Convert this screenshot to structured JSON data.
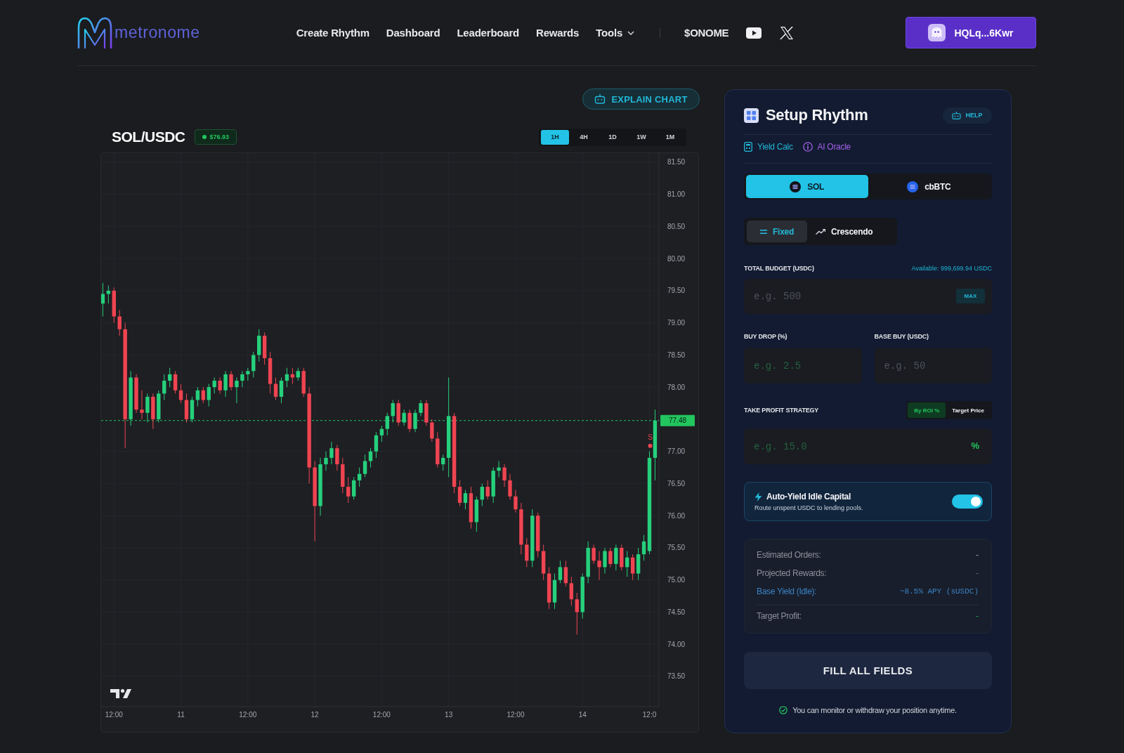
{
  "header": {
    "logo": "metronome",
    "nav": [
      {
        "label": "Create Rhythm",
        "dropdown": false
      },
      {
        "label": "Dashboard",
        "dropdown": false
      },
      {
        "label": "Leaderboard",
        "dropdown": false
      },
      {
        "label": "Rewards",
        "dropdown": false
      },
      {
        "label": "Tools",
        "dropdown": true
      }
    ],
    "token": "$ONOME",
    "wallet": "HQLq...6Kwr"
  },
  "chart": {
    "explain_button": "EXPLAIN CHART",
    "pair": "SOL/USDC",
    "price_badge": "$76.93",
    "timeframes": [
      {
        "label": "1H",
        "selected": true
      },
      {
        "label": "4H",
        "selected": false
      },
      {
        "label": "1D",
        "selected": false
      },
      {
        "label": "1W",
        "selected": false
      },
      {
        "label": "1M",
        "selected": false
      }
    ],
    "chart_data": [
      {
        "type": "candlestick",
        "categories": [
          null,
          null,
          "12:00",
          null,
          null,
          null,
          null,
          null,
          null,
          null,
          null,
          null,
          null,
          null,
          "11",
          null,
          null,
          null,
          null,
          null,
          null,
          null,
          null,
          null,
          null,
          null,
          "12:00",
          null,
          null,
          null,
          null,
          null,
          null,
          null,
          null,
          null,
          null,
          null,
          "12",
          null,
          null,
          null,
          null,
          null,
          null,
          null,
          null,
          null,
          null,
          null,
          "12:00",
          null,
          null,
          null,
          null,
          null,
          null,
          null,
          null,
          null,
          null,
          null,
          "13",
          null,
          null,
          null,
          null,
          null,
          null,
          null,
          null,
          null,
          null,
          null,
          "12:00",
          null,
          null,
          null,
          null,
          null,
          null,
          null,
          null,
          null,
          null,
          null,
          "14",
          null,
          null,
          null,
          null,
          null,
          null,
          null,
          null,
          null,
          null,
          null,
          "12:0",
          null
        ],
        "ohlc": [
          [
            79.3,
            79.62,
            79.1,
            79.45
          ],
          [
            79.45,
            79.58,
            79.3,
            79.5
          ],
          [
            79.5,
            79.55,
            79.0,
            79.1
          ],
          [
            79.1,
            79.2,
            78.8,
            78.9
          ],
          [
            78.9,
            79.0,
            77.05,
            77.5
          ],
          [
            77.5,
            78.25,
            77.4,
            78.15
          ],
          [
            78.15,
            78.2,
            77.6,
            77.65
          ],
          [
            77.65,
            77.95,
            77.5,
            77.6
          ],
          [
            77.6,
            77.9,
            77.45,
            77.85
          ],
          [
            77.85,
            77.9,
            77.35,
            77.5
          ],
          [
            77.5,
            77.95,
            77.45,
            77.9
          ],
          [
            77.9,
            78.2,
            77.8,
            78.1
          ],
          [
            78.1,
            78.3,
            78.0,
            78.2
          ],
          [
            78.2,
            78.25,
            77.9,
            77.95
          ],
          [
            77.95,
            78.05,
            77.75,
            77.8
          ],
          [
            77.8,
            77.9,
            77.45,
            77.5
          ],
          [
            77.5,
            77.85,
            77.45,
            77.8
          ],
          [
            77.8,
            78.0,
            77.7,
            77.95
          ],
          [
            77.95,
            78.0,
            77.75,
            77.8
          ],
          [
            77.8,
            78.05,
            77.7,
            78.0
          ],
          [
            78.0,
            78.15,
            77.9,
            78.1
          ],
          [
            78.1,
            78.15,
            77.9,
            77.95
          ],
          [
            77.95,
            78.25,
            77.85,
            78.2
          ],
          [
            78.2,
            78.25,
            77.95,
            78.0
          ],
          [
            78.0,
            78.15,
            77.75,
            78.1
          ],
          [
            78.1,
            78.25,
            78.0,
            78.2
          ],
          [
            78.2,
            78.3,
            78.1,
            78.25
          ],
          [
            78.25,
            78.55,
            78.15,
            78.5
          ],
          [
            78.5,
            78.9,
            78.4,
            78.8
          ],
          [
            78.8,
            78.85,
            78.35,
            78.45
          ],
          [
            78.45,
            78.55,
            77.9,
            78.05
          ],
          [
            78.05,
            78.15,
            77.8,
            77.85
          ],
          [
            77.85,
            78.15,
            77.75,
            78.1
          ],
          [
            78.1,
            78.3,
            78.0,
            78.2
          ],
          [
            78.2,
            78.3,
            78.05,
            78.15
          ],
          [
            78.15,
            78.3,
            78.1,
            78.25
          ],
          [
            78.25,
            78.3,
            77.85,
            77.9
          ],
          [
            77.9,
            78.0,
            76.5,
            76.75
          ],
          [
            76.75,
            76.85,
            75.6,
            76.15
          ],
          [
            76.15,
            76.9,
            76.0,
            76.8
          ],
          [
            76.8,
            77.0,
            76.7,
            76.9
          ],
          [
            76.9,
            77.15,
            76.8,
            77.05
          ],
          [
            77.05,
            77.1,
            76.7,
            76.8
          ],
          [
            76.8,
            76.9,
            76.35,
            76.45
          ],
          [
            76.45,
            76.6,
            76.2,
            76.3
          ],
          [
            76.3,
            76.6,
            76.25,
            76.55
          ],
          [
            76.55,
            76.75,
            76.45,
            76.65
          ],
          [
            76.65,
            76.95,
            76.6,
            76.85
          ],
          [
            76.85,
            77.05,
            76.75,
            77.0
          ],
          [
            77.0,
            77.3,
            76.9,
            77.25
          ],
          [
            77.25,
            77.4,
            77.15,
            77.35
          ],
          [
            77.35,
            77.6,
            77.25,
            77.55
          ],
          [
            77.55,
            77.8,
            77.45,
            77.75
          ],
          [
            77.75,
            77.8,
            77.4,
            77.45
          ],
          [
            77.45,
            77.65,
            77.4,
            77.6
          ],
          [
            77.6,
            77.65,
            77.3,
            77.35
          ],
          [
            77.35,
            77.65,
            77.3,
            77.6
          ],
          [
            77.6,
            77.8,
            77.55,
            77.75
          ],
          [
            77.75,
            77.8,
            77.4,
            77.45
          ],
          [
            77.45,
            77.5,
            77.15,
            77.2
          ],
          [
            77.2,
            77.3,
            76.75,
            76.8
          ],
          [
            76.8,
            76.95,
            76.7,
            76.9
          ],
          [
            76.9,
            78.15,
            76.6,
            77.55
          ],
          [
            77.55,
            77.6,
            76.35,
            76.45
          ],
          [
            76.45,
            76.55,
            76.15,
            76.2
          ],
          [
            76.2,
            76.4,
            76.1,
            76.35
          ],
          [
            76.35,
            76.45,
            75.8,
            75.9
          ],
          [
            75.9,
            76.3,
            75.75,
            76.25
          ],
          [
            76.25,
            76.5,
            76.15,
            76.45
          ],
          [
            76.45,
            76.55,
            76.25,
            76.3
          ],
          [
            76.3,
            76.75,
            76.2,
            76.7
          ],
          [
            76.7,
            76.85,
            76.6,
            76.75
          ],
          [
            76.75,
            76.8,
            76.45,
            76.55
          ],
          [
            76.55,
            76.65,
            76.25,
            76.3
          ],
          [
            76.3,
            76.4,
            76.05,
            76.1
          ],
          [
            76.1,
            76.2,
            75.4,
            75.55
          ],
          [
            75.55,
            75.65,
            75.2,
            75.3
          ],
          [
            75.3,
            76.1,
            75.2,
            76.0
          ],
          [
            76.0,
            76.05,
            75.35,
            75.45
          ],
          [
            75.45,
            75.55,
            75.0,
            75.1
          ],
          [
            75.1,
            75.2,
            74.55,
            74.65
          ],
          [
            74.65,
            75.1,
            74.55,
            75.0
          ],
          [
            75.0,
            75.3,
            74.95,
            75.2
          ],
          [
            75.2,
            75.3,
            74.9,
            74.95
          ],
          [
            74.95,
            75.05,
            74.6,
            74.7
          ],
          [
            74.7,
            74.8,
            74.15,
            74.5
          ],
          [
            74.5,
            75.1,
            74.4,
            75.05
          ],
          [
            75.05,
            75.6,
            74.95,
            75.5
          ],
          [
            75.5,
            75.55,
            75.25,
            75.3
          ],
          [
            75.3,
            75.45,
            75.0,
            75.2
          ],
          [
            75.2,
            75.5,
            75.1,
            75.45
          ],
          [
            75.45,
            75.5,
            75.2,
            75.25
          ],
          [
            75.25,
            75.55,
            75.15,
            75.5
          ],
          [
            75.5,
            75.55,
            75.15,
            75.2
          ],
          [
            75.2,
            75.45,
            75.05,
            75.35
          ],
          [
            75.35,
            75.4,
            75.0,
            75.1
          ],
          [
            75.1,
            75.5,
            75.0,
            75.4
          ],
          [
            75.4,
            75.7,
            75.3,
            75.6
          ],
          [
            75.45,
            77.0,
            75.4,
            76.9
          ],
          [
            76.9,
            77.65,
            76.55,
            77.48
          ]
        ],
        "ylim": [
          73.03,
          81.64
        ],
        "yticks": [
          {
            "value": 73.5,
            "label": "73.50"
          },
          {
            "value": 74,
            "label": "74.00"
          },
          {
            "value": 74.5,
            "label": "74.50"
          },
          {
            "value": 75,
            "label": "75.00"
          },
          {
            "value": 75.5,
            "label": "75.50"
          },
          {
            "value": 76,
            "label": "76.00"
          },
          {
            "value": 76.5,
            "label": "76.50"
          },
          {
            "value": 77,
            "label": "77.00"
          },
          {
            "value": 78,
            "label": "78.00"
          },
          {
            "value": 78.5,
            "label": "78.50"
          },
          {
            "value": 79,
            "label": "79.00"
          },
          {
            "value": 79.5,
            "label": "79.50"
          },
          {
            "value": 80,
            "label": "80.00"
          },
          {
            "value": 80.5,
            "label": "80.50"
          },
          {
            "value": 81,
            "label": "81.00"
          },
          {
            "value": 81.5,
            "label": "81.50"
          }
        ],
        "grid": true,
        "ref_lines": [
          {
            "axis": "y",
            "value": 77.48,
            "label": "77.48",
            "color": "#22c55e",
            "line_style": "dashed"
          }
        ],
        "annotations": [
          "S"
        ]
      }
    ]
  },
  "setup": {
    "title": "Setup Rhythm",
    "help_button": "HELP",
    "links": [
      {
        "label": "Yield Calc",
        "kind": "calc"
      },
      {
        "label": "AI Oracle",
        "kind": "oracle"
      }
    ],
    "assets": [
      {
        "label": "SOL",
        "selected": true,
        "color": "#111318"
      },
      {
        "label": "cbBTC",
        "selected": false,
        "color": "#2563eb"
      }
    ],
    "modes": [
      {
        "label": "Fixed",
        "selected": true,
        "kind": "flat"
      },
      {
        "label": "Crescendo",
        "selected": false,
        "kind": "rising"
      }
    ],
    "budget": {
      "label": "TOTAL BUDGET (USDC)",
      "available": "Available: 999,699.94 USDC",
      "placeholder": "e.g. 500",
      "max_button": "MAX"
    },
    "fields": [
      {
        "label": "BUY DROP (%)",
        "placeholder": "e.g. 2.5",
        "kind": "percent"
      },
      {
        "label": "BASE BUY (USDC)",
        "placeholder": "e.g. 50",
        "kind": "amount"
      }
    ],
    "take_profit": {
      "label": "TAKE PROFIT STRATEGY",
      "options": [
        {
          "label": "By ROI %",
          "selected": true
        },
        {
          "label": "Target Price",
          "selected": false
        }
      ],
      "placeholder": "e.g. 15.0",
      "suffix": "%"
    },
    "auto_yield": {
      "title": "Auto-Yield Idle Capital",
      "subtitle": "Route unspent USDC to lending pools.",
      "on": true
    },
    "summary": [
      {
        "label": "Estimated Orders:",
        "value": "-",
        "kind": "plain"
      },
      {
        "label": "Projected Rewards:",
        "value": "-",
        "kind": "muted"
      },
      {
        "label": "Base Yield (Idle):",
        "value": "~8.5% APY (sUSDC)",
        "kind": "info"
      },
      {
        "label": "Target Profit:",
        "value": "-",
        "kind": "profit"
      }
    ],
    "submit_button": {
      "label": "FILL ALL FIELDS",
      "disabled": true
    },
    "note": "You can monitor or withdraw your position anytime."
  }
}
